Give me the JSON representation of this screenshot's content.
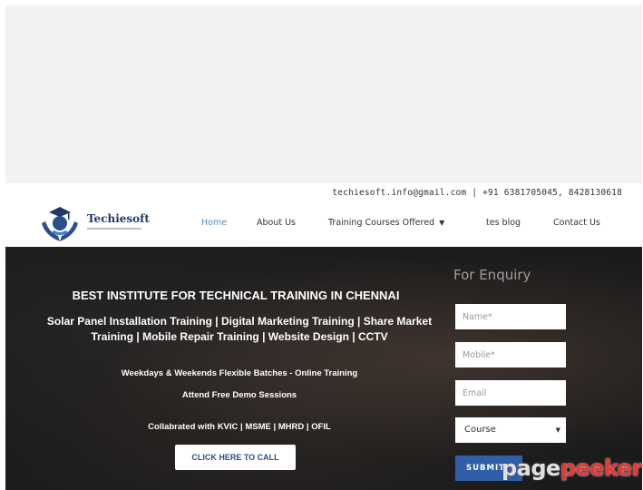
{
  "header": {
    "contact": "techiesoft.info@gmail.com | +91 6381705045, 8428130618"
  },
  "logo": {
    "name": "Techiesoft",
    "icon": "graduate-hands-logo-icon"
  },
  "nav": {
    "items": [
      {
        "label": "Home",
        "active": true
      },
      {
        "label": "About Us"
      },
      {
        "label": "Training Courses Offered",
        "has_dropdown": true
      },
      {
        "label": "tes blog"
      },
      {
        "label": "Contact Us"
      }
    ],
    "dropdown_icon": "chevron-down-icon"
  },
  "hero": {
    "title": "BEST INSTITUTE FOR TECHNICAL TRAINING IN CHENNAI",
    "courses": "Solar Panel Installation Training | Digital Marketing Training | Share Market Training | Mobile Repair Training | Website Design | CCTV",
    "batches": "Weekdays & Weekends Flexible Batches - Online Training",
    "demo": "Attend Free Demo Sessions",
    "collab": "Collabrated with KVIC | MSME | MHRD | OFIL",
    "cta_label": "CLICK HERE TO CALL"
  },
  "enquiry": {
    "title": "For Enquiry",
    "name_placeholder": "Name*",
    "mobile_placeholder": "Mobile*",
    "email_placeholder": "Email",
    "course_selected": "Course",
    "submit_label": "SUBMIT"
  },
  "watermark": {
    "part1": "page",
    "part2": "peeker"
  },
  "colors": {
    "accent": "#4f8fc4",
    "submit": "#2f5fa8",
    "watermark_red": "#e53935"
  }
}
